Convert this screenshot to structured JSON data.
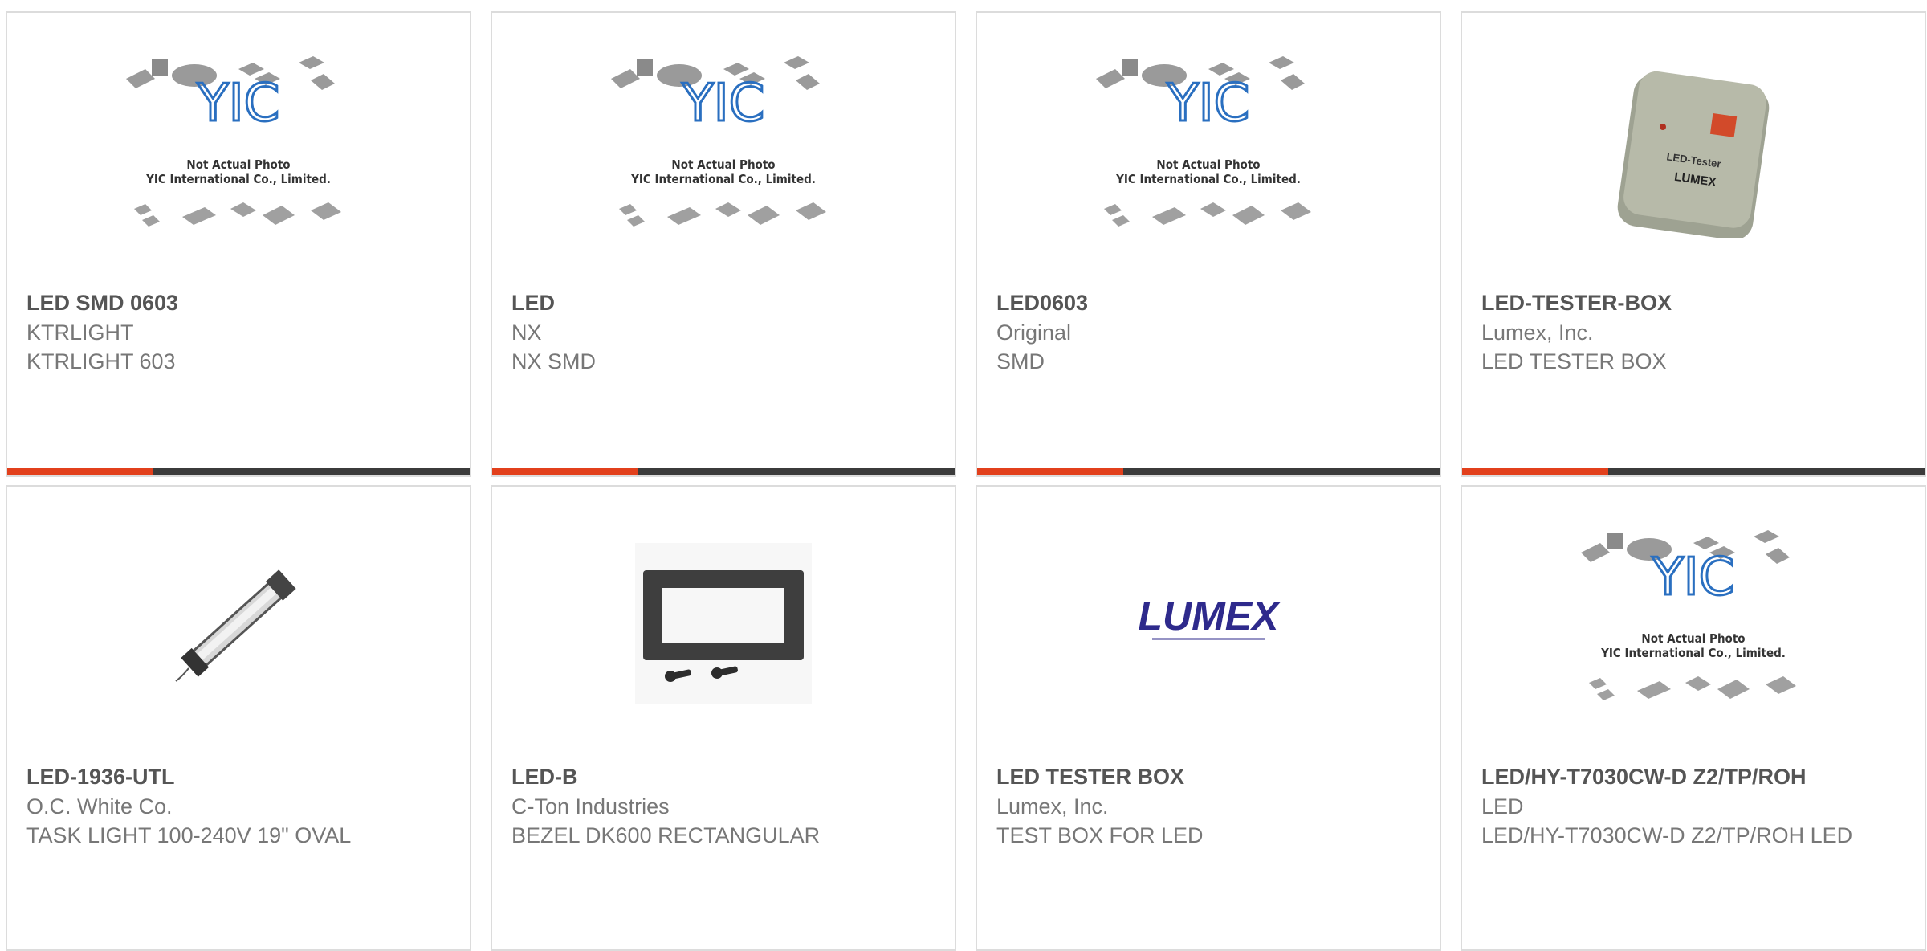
{
  "products": [
    {
      "part": "LED SMD 0603",
      "maker": "KTRLIGHT",
      "desc": "KTRLIGHT 603",
      "image": "yic-placeholder",
      "image_text": [
        "Not Actual Photo",
        "YIC International Co., Limited."
      ]
    },
    {
      "part": "LED",
      "maker": "NX",
      "desc": "NX SMD",
      "image": "yic-placeholder",
      "image_text": [
        "Not Actual Photo",
        "YIC International Co., Limited."
      ]
    },
    {
      "part": "LED0603",
      "maker": "Original",
      "desc": "SMD",
      "image": "yic-placeholder",
      "image_text": [
        "Not Actual Photo",
        "YIC International Co., Limited."
      ]
    },
    {
      "part": "LED-TESTER-BOX",
      "maker": "Lumex, Inc.",
      "desc": "LED TESTER BOX",
      "image": "led-tester-photo",
      "image_text": []
    },
    {
      "part": "LED-1936-UTL",
      "maker": "O.C. White Co.",
      "desc": "TASK LIGHT 100-240V 19\" OVAL",
      "image": "task-light-photo",
      "image_text": []
    },
    {
      "part": "LED-B",
      "maker": "C-Ton Industries",
      "desc": "BEZEL DK600 RECTANGULAR",
      "image": "bezel-photo",
      "image_text": []
    },
    {
      "part": "LED TESTER BOX",
      "maker": "Lumex, Inc.",
      "desc": "TEST BOX FOR LED",
      "image": "lumex-logo",
      "image_text": [
        "LUMEX"
      ]
    },
    {
      "part": "LED/HY-T7030CW-D Z2/TP/ROH",
      "maker": "LED",
      "desc": "LED/HY-T7030CW-D Z2/TP/ROH LED",
      "image": "yic-placeholder",
      "image_text": [
        "Not Actual Photo",
        "YIC International Co., Limited."
      ]
    }
  ],
  "colors": {
    "accent": "#e2401c",
    "bar": "#3b3b3b",
    "border": "#dcdcdc",
    "title": "#555555",
    "text": "#777777"
  }
}
